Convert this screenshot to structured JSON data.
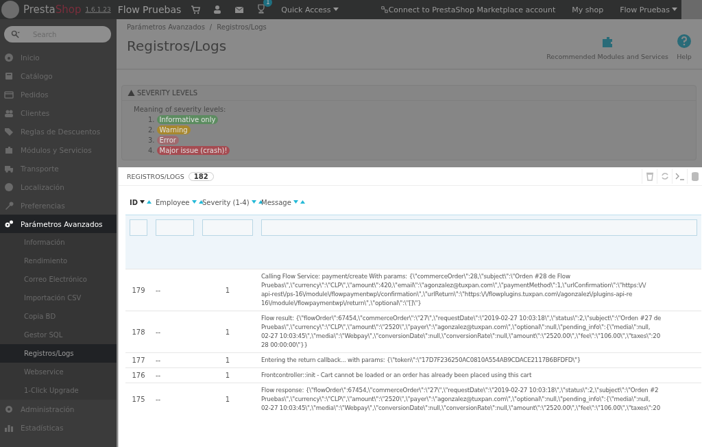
{
  "topbar": {
    "brand_a": "Presta",
    "brand_b": "Shop",
    "version": "1.6.1.23",
    "shop_name": "Flow Pruebas",
    "notification_count": "1",
    "quick_access": "Quick Access",
    "connect": "Connect to PrestaShop Marketplace account",
    "my_shop": "My shop",
    "employee": "Flow Pruebas"
  },
  "sidebar": {
    "search": {
      "placeholder": "Search"
    },
    "items": [
      {
        "label": "Inicio",
        "selected": false
      },
      {
        "label": "Catálogo",
        "selected": false
      },
      {
        "label": "Pedidos",
        "selected": false
      },
      {
        "label": "Clientes",
        "selected": false
      },
      {
        "label": "Reglas de Descuentos",
        "selected": false
      },
      {
        "label": "Módulos y Servicios",
        "selected": false
      },
      {
        "label": "Transporte",
        "selected": false
      },
      {
        "label": "Localización",
        "selected": false
      },
      {
        "label": "Preferencias",
        "selected": false
      },
      {
        "label": "Parámetros Avanzados",
        "selected": true,
        "expanded": true,
        "children": [
          {
            "label": "Información",
            "selected": false
          },
          {
            "label": "Rendimiento",
            "selected": false
          },
          {
            "label": "Correo Electrónico",
            "selected": false
          },
          {
            "label": "Importación CSV",
            "selected": false
          },
          {
            "label": "Copia BD",
            "selected": false
          },
          {
            "label": "Gestor SQL",
            "selected": false
          },
          {
            "label": "Registros/Logs",
            "selected": true
          },
          {
            "label": "Webservice",
            "selected": false
          },
          {
            "label": "1-Click Upgrade",
            "selected": false
          }
        ]
      },
      {
        "label": "Administración",
        "selected": false
      },
      {
        "label": "Estadísticas",
        "selected": false
      }
    ]
  },
  "page_header": {
    "breadcrumb": [
      "Parámetros Avanzados",
      "Registros/Logs"
    ],
    "breadcrumb_separator": "/",
    "title": "Registros/Logs",
    "toolbar": [
      "Recommended Modules and Services",
      "Help"
    ]
  },
  "severity_panel": {
    "title": "SEVERITY LEVELS",
    "intro": "Meaning of severity levels:",
    "levels": [
      {
        "number": "1.",
        "label": "Informative only",
        "color": "#5c8c60"
      },
      {
        "number": "2.",
        "label": "Warning",
        "color": "#a8882e"
      },
      {
        "number": "3.",
        "label": "Error",
        "color": "#a06a6e"
      },
      {
        "number": "4.",
        "label": "Major issue (crash)!",
        "color": "#a54c52"
      }
    ]
  },
  "logs_panel": {
    "title": "REGISTROS/LOGS",
    "count": "182",
    "columns": [
      {
        "label": "ID",
        "sorted": true
      },
      {
        "label": "Employee",
        "sorted": false
      },
      {
        "label": "Severity (1-4)",
        "sorted": false
      },
      {
        "label": "Message",
        "sorted": false
      }
    ],
    "rows": [
      {
        "id": "179",
        "employee": "--",
        "severity": "1",
        "message": [
          "Calling Flow Service: payment/create With params: {\\\"commerceOrder\\\":28,\\\"subject\\\":\\\"Orden #28 de Flow",
          "Pruebas\\\",\\\"currency\\\":\\\"CLP\\\",\\\"amount\\\":420,\\\"email\\\":\\\"agonzalez@tuxpan.com\\\",\\\"paymentMethod\\\":1,\\\"urlConfirmation\\\":\\\"https:\\/\\/",
          "api-rest\\/ps-16\\/module\\/flowpaymentwp\\/confirmation\\\",\\\"urlReturn\\\":\\\"https:\\/\\/flowplugins.tuxpan.com\\/agonzalez\\/plugins-api-re",
          "16\\/module\\/flowpaymentwp\\/return\\\",\\\"optional\\\":\\\"[]\\\"}"
        ]
      },
      {
        "id": "178",
        "employee": "--",
        "severity": "1",
        "message": [
          "Flow result: {\\\"flowOrder\\\":67454,\\\"commerceOrder\\\":\\\"27\\\",\\\"requestDate\\\":\\\"2019-02-27 10:03:18\\\",\\\"status\\\":2,\\\"subject\\\":\\\"Orden #27 de",
          "Pruebas\\\",\\\"currency\\\":\\\"CLP\\\",\\\"amount\\\":\\\"2520\\\",\\\"payer\\\":\\\"agonzalez@tuxpan.com\\\",\\\"optional\\\":null,\\\"pending_info\\\":{\\\"media\\\":null,",
          "02-27 10:03:45\\\",\\\"media\\\":\\\"Webpay\\\",\\\"conversionDate\\\":null,\\\"conversionRate\\\":null,\\\"amount\\\":\\\"2520.00\\\",\\\"fee\\\":\\\"106.00\\\",\\\"taxes\\\":20",
          "28 00:00:00\\\"}}"
        ]
      },
      {
        "id": "177",
        "employee": "--",
        "severity": "1",
        "message": [
          "Entering the return callback... with params: {\\\"token\\\":\\\"17D7F236250AC0810A554AB9CDACE2117B6BFDFD\\\"}"
        ]
      },
      {
        "id": "176",
        "employee": "--",
        "severity": "1",
        "message": [
          "Frontcontroller::init - Cart cannot be loaded or an order has already been placed using this cart"
        ]
      },
      {
        "id": "175",
        "employee": "--",
        "severity": "1",
        "message": [
          "Flow response: {\\\"flowOrder\\\":67454,\\\"commerceOrder\\\":\\\"27\\\",\\\"requestDate\\\":\\\"2019-02-27 10:03:18\\\",\\\"status\\\":2,\\\"subject\\\":\\\"Orden #2",
          "Pruebas\\\",\\\"currency\\\":\\\"CLP\\\",\\\"amount\\\":\\\"2520\\\",\\\"payer\\\":\\\"agonzalez@tuxpan.com\\\",\\\"optional\\\":null,\\\"pending_info\\\":{\\\"media\\\":null,",
          "02-27 10:03:45\\\",\\\"media\\\":\\\"Webpay\\\",\\\"conversionDate\\\":null,\\\"conversionRate\\\":null,\\\"amount\\\":\\\"2520.00\\\",\\\"fee\\\":\\\"106.00\\\",\\\"taxes\\\":20"
        ]
      }
    ]
  }
}
